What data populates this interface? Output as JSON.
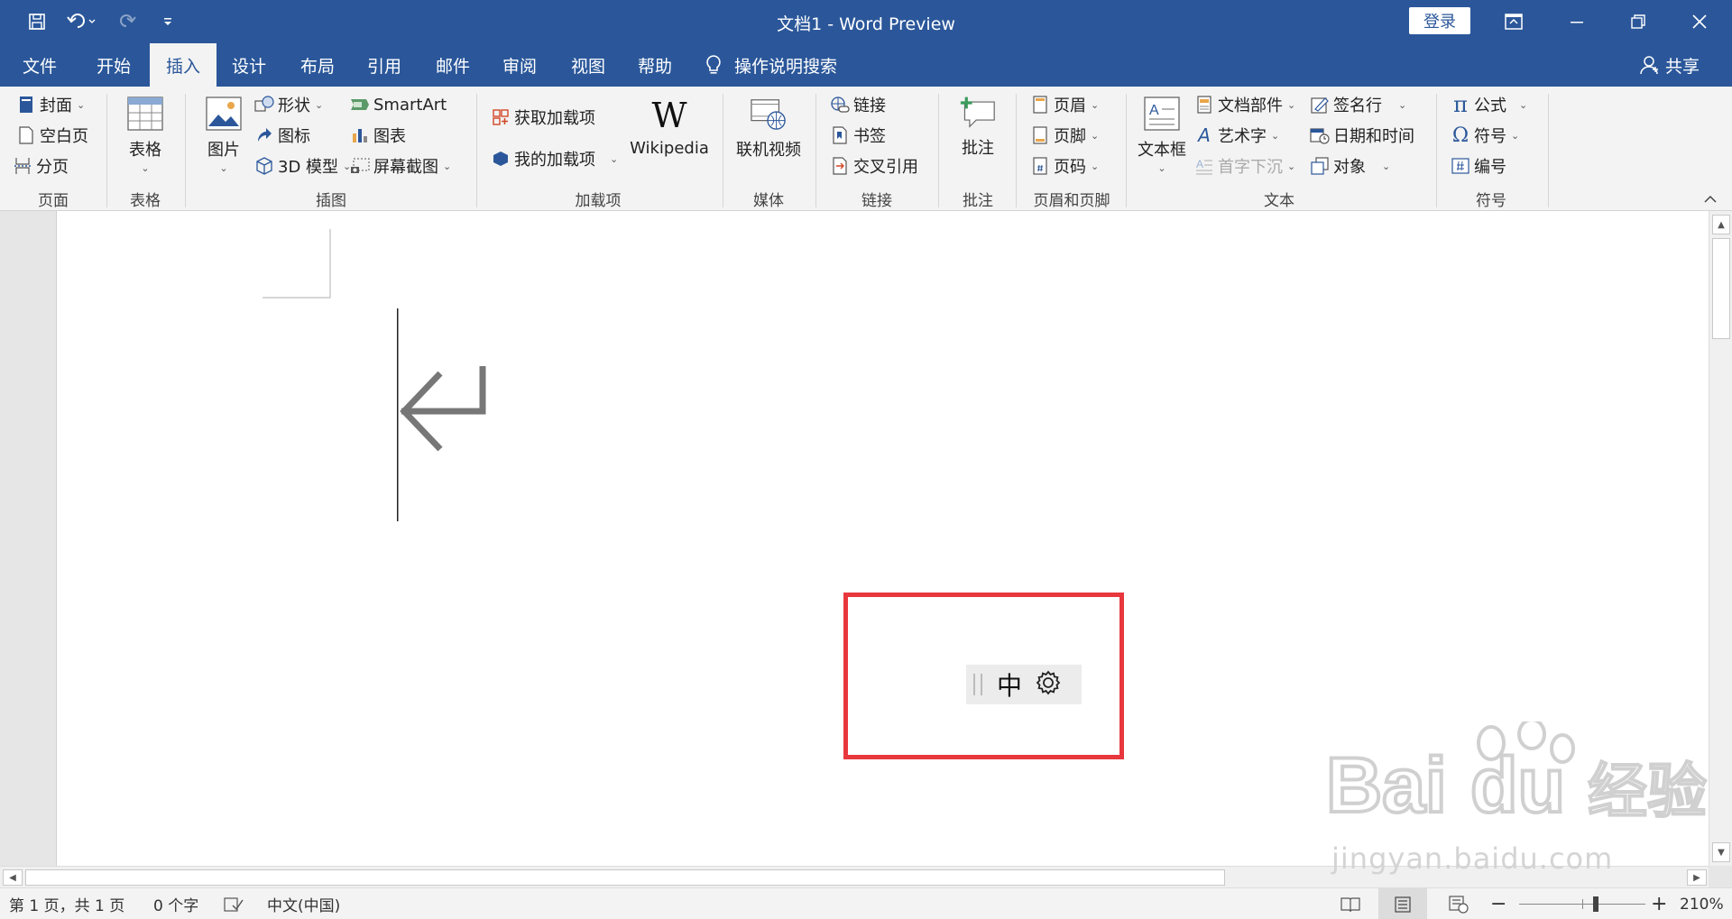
{
  "window": {
    "title": "文档1  -  Word Preview",
    "login_label": "登录"
  },
  "tabs": [
    {
      "label": "文件",
      "active": false
    },
    {
      "label": "开始",
      "active": false
    },
    {
      "label": "插入",
      "active": true
    },
    {
      "label": "设计",
      "active": false
    },
    {
      "label": "布局",
      "active": false
    },
    {
      "label": "引用",
      "active": false
    },
    {
      "label": "邮件",
      "active": false
    },
    {
      "label": "审阅",
      "active": false
    },
    {
      "label": "视图",
      "active": false
    },
    {
      "label": "帮助",
      "active": false
    }
  ],
  "tell_me": "操作说明搜索",
  "share": "共享",
  "ribbon": {
    "pages": {
      "label": "页面",
      "cover": "封面",
      "blank_page": "空白页",
      "page_break": "分页"
    },
    "tables": {
      "label": "表格",
      "table": "表格"
    },
    "illustrations": {
      "label": "插图",
      "pictures": "图片",
      "shapes": "形状",
      "icons": "图标",
      "model3d": "3D 模型",
      "smartart": "SmartArt",
      "chart": "图表",
      "screenshot": "屏幕截图"
    },
    "addins": {
      "label": "加载项",
      "get_addins": "获取加载项",
      "my_addins": "我的加载项",
      "wikipedia": "Wikipedia",
      "wikipedia_glyph": "W"
    },
    "media": {
      "label": "媒体",
      "online_video": "联机视频"
    },
    "links": {
      "label": "链接",
      "link": "链接",
      "bookmark": "书签",
      "cross_ref": "交叉引用"
    },
    "comments": {
      "label": "批注",
      "comment": "批注"
    },
    "header_footer": {
      "label": "页眉和页脚",
      "header": "页眉",
      "footer": "页脚",
      "page_number": "页码"
    },
    "text": {
      "label": "文本",
      "textbox": "文本框",
      "quick_parts": "文档部件",
      "wordart": "艺术字",
      "dropcap": "首字下沉",
      "signature": "签名行",
      "datetime": "日期和时间",
      "object": "对象"
    },
    "symbols": {
      "label": "符号",
      "equation": "公式",
      "symbol": "符号",
      "number": "编号"
    }
  },
  "ime": {
    "lang": "中"
  },
  "watermark": {
    "brand": "Bai",
    "brand2": "du",
    "cn": "经验",
    "url": "jingyan.baidu.com"
  },
  "status": {
    "page": "第 1 页，共 1 页",
    "words": "0 个字",
    "language": "中文(中国)",
    "zoom": "210%",
    "zoom_minus": "−",
    "zoom_plus": "+"
  },
  "colors": {
    "brand": "#2b579a",
    "highlight": "#e8373d"
  }
}
